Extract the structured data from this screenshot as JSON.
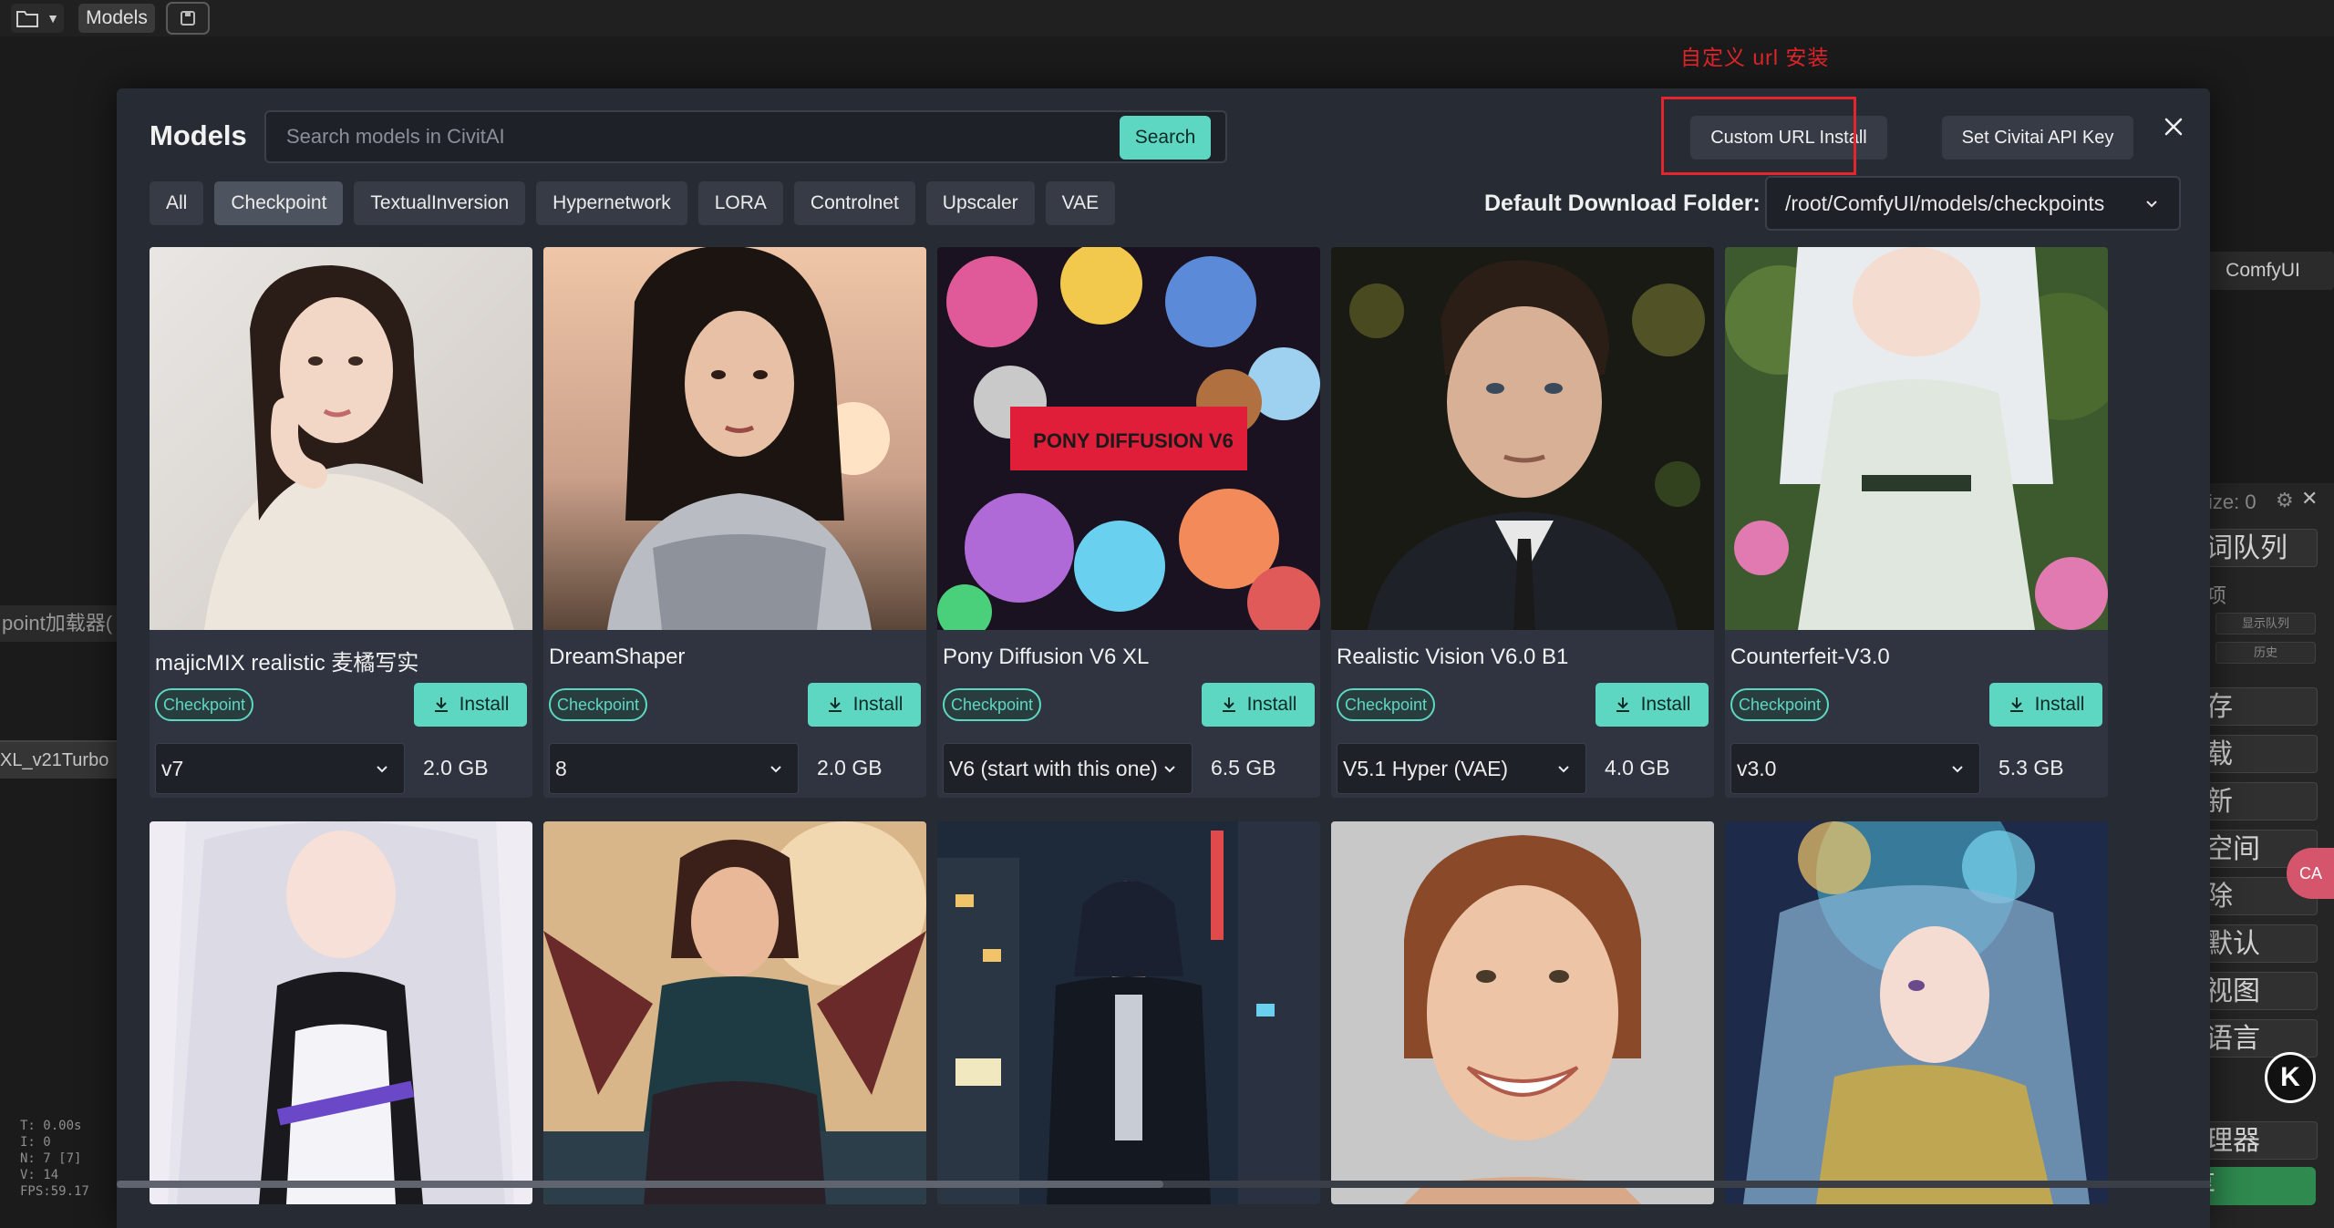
{
  "topbar": {
    "models_label": "Models"
  },
  "annotation": {
    "label": "自定义 url 安装"
  },
  "background": {
    "left_label": "point加载器(",
    "left_node": "XL_v21Turbo",
    "stats": [
      "T: 0.00s",
      "I: 0",
      "N: 7 [7]",
      "V: 14",
      "FPS:59.17"
    ],
    "right_comfy": "ComfyUI",
    "right_size": "ize: 0",
    "right_buttons": [
      "词队列",
      "存",
      "载",
      "新",
      "空间",
      "除",
      "默认",
      "视图",
      "语言",
      "理器"
    ],
    "right_small": "项",
    "right_tiny": [
      "显示队列",
      "历史"
    ],
    "right_green": "分享",
    "pink_float": "CA",
    "k_badge": "K"
  },
  "modal": {
    "title": "Models",
    "search_placeholder": "Search models in CivitAI",
    "search_button": "Search",
    "custom_url_button": "Custom URL Install",
    "api_key_button": "Set Civitai API Key",
    "tabs": [
      "All",
      "Checkpoint",
      "TextualInversion",
      "Hypernetwork",
      "LORA",
      "Controlnet",
      "Upscaler",
      "VAE"
    ],
    "active_tab": "Checkpoint",
    "folder_label": "Default Download Folder:",
    "folder_value": "/root/ComfyUI/models/checkpoints",
    "install_label": "Install",
    "cards": [
      {
        "name": "majicMIX realistic 麦橘写实",
        "type": "Checkpoint",
        "version": "v7",
        "size": "2.0 GB"
      },
      {
        "name": "DreamShaper",
        "type": "Checkpoint",
        "version": "8",
        "size": "2.0 GB"
      },
      {
        "name": "Pony Diffusion V6 XL",
        "type": "Checkpoint",
        "version": "V6 (start with this one)",
        "size": "6.5 GB",
        "poster_text": "PONY DIFFUSION V6"
      },
      {
        "name": "Realistic Vision V6.0 B1",
        "type": "Checkpoint",
        "version": "V5.1 Hyper (VAE)",
        "size": "4.0 GB"
      },
      {
        "name": "Counterfeit-V3.0",
        "type": "Checkpoint",
        "version": "v3.0",
        "size": "5.3 GB"
      }
    ],
    "scroll_position": 0.5
  },
  "icons": {
    "folder": "folder-icon",
    "save": "save-icon",
    "close": "close-icon",
    "download": "download-icon",
    "chevron": "chevron-down-icon"
  },
  "colors": {
    "accent": "#5ed7c2",
    "modal_bg": "#272b33",
    "annotation_red": "#e4262c"
  }
}
